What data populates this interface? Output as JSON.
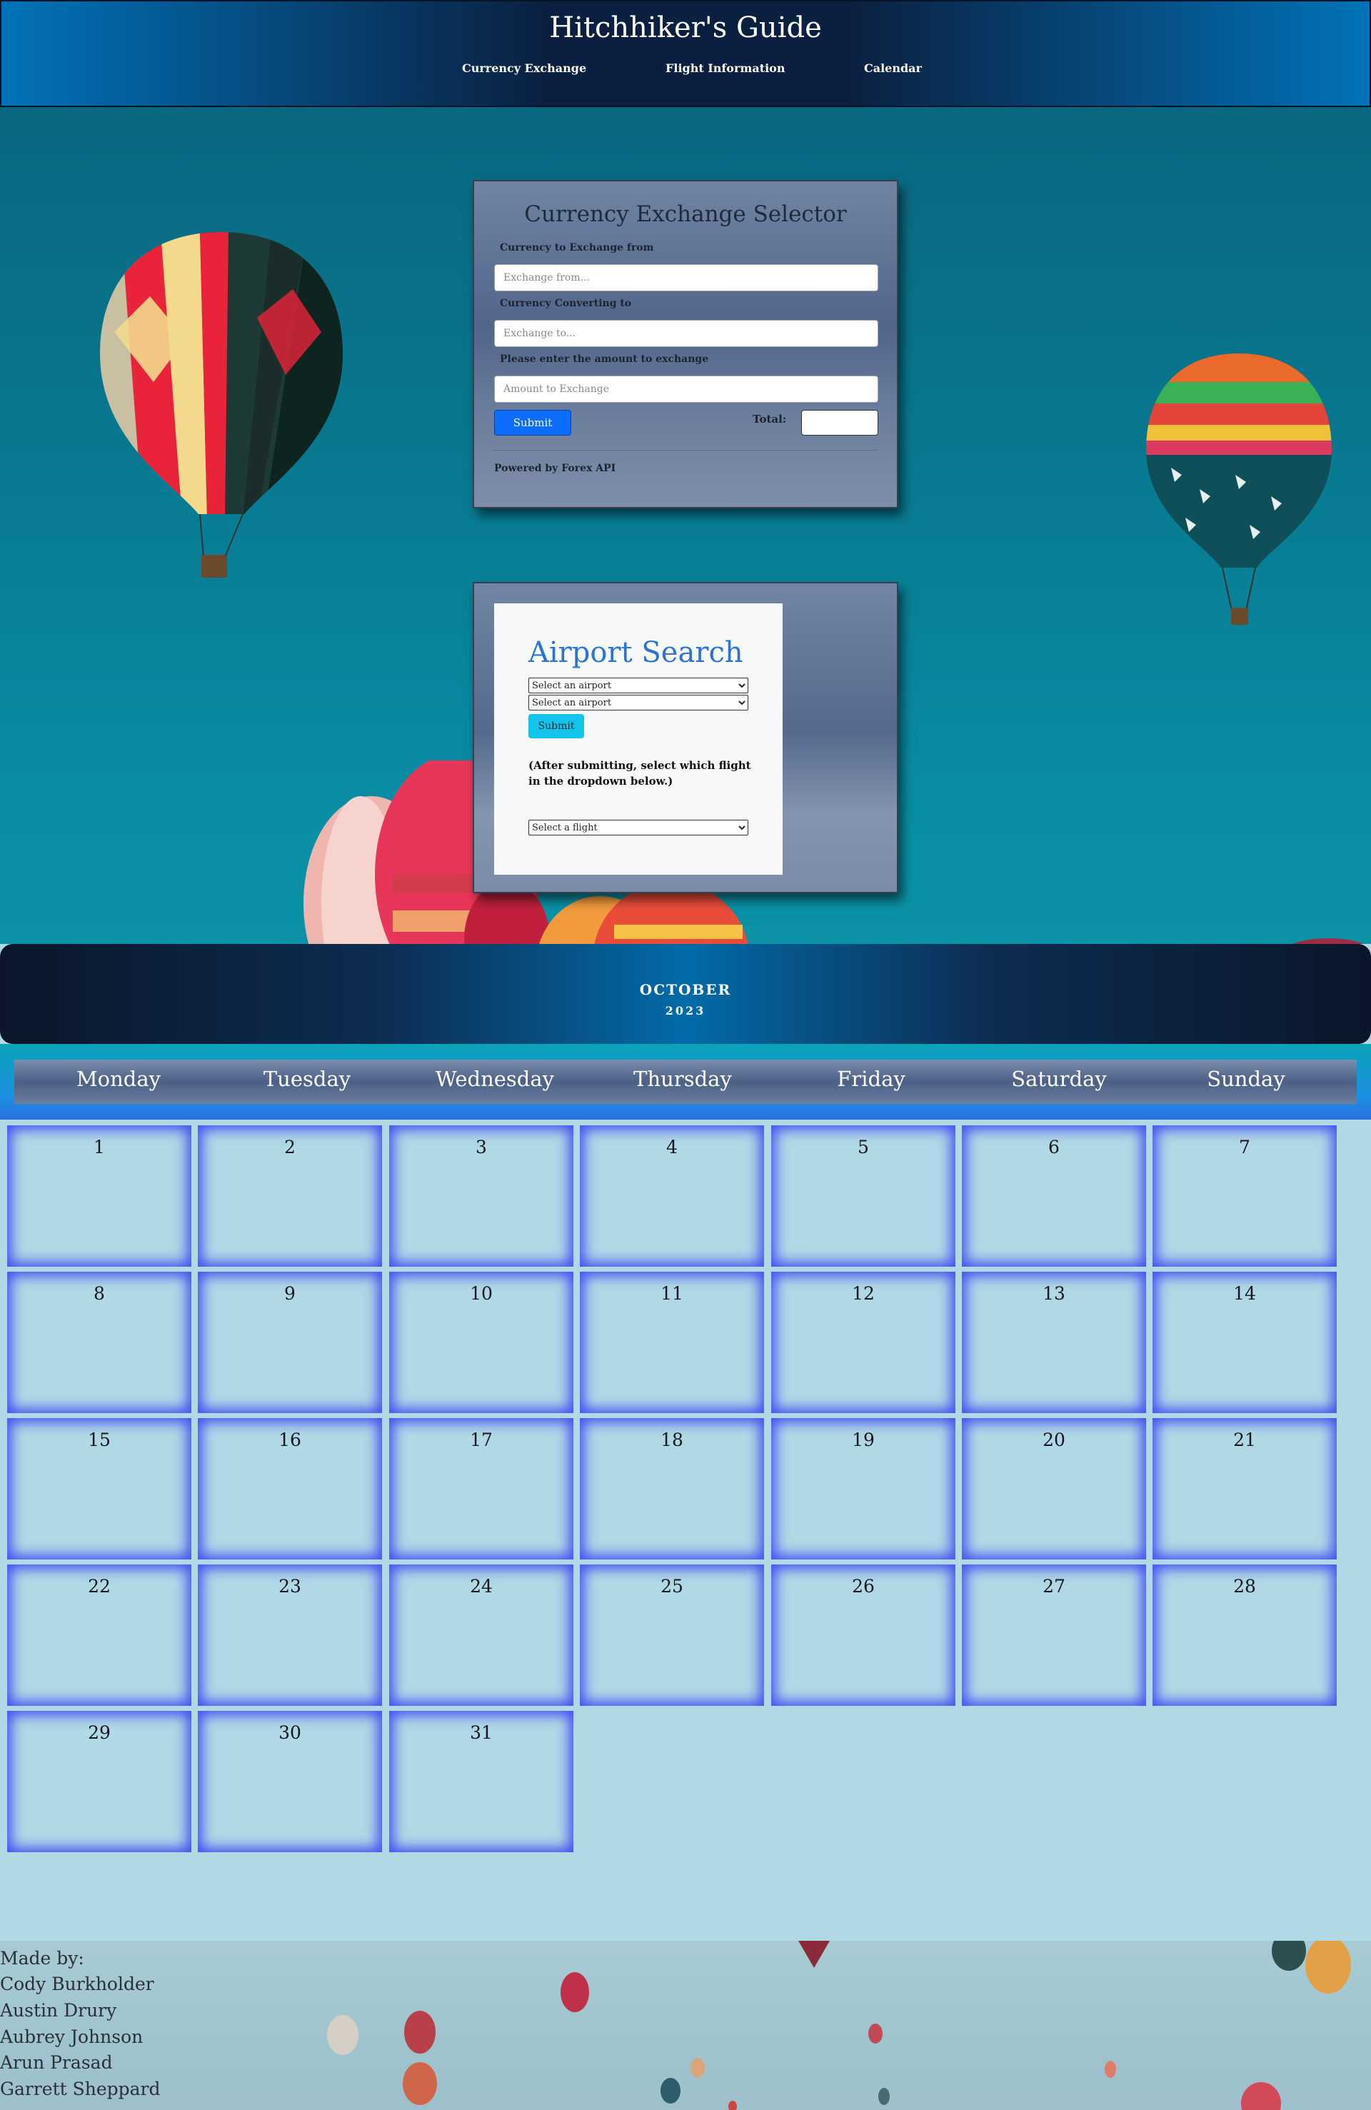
{
  "header": {
    "title": "Hitchhiker's Guide",
    "nav": [
      {
        "label": "Currency Exchange"
      },
      {
        "label": "Flight Information"
      },
      {
        "label": "Calendar"
      }
    ]
  },
  "currency": {
    "title": "Currency Exchange Selector",
    "from_label": "Currency to Exchange from",
    "from_placeholder": "Exchange from...",
    "to_label": "Currency Converting to",
    "to_placeholder": "Exchange to...",
    "amount_label": "Please enter the amount to exchange",
    "amount_placeholder": "Amount to Exchange",
    "submit_label": "Submit",
    "total_label": "Total:",
    "total_value": "",
    "powered_by": "Powered by Forex API"
  },
  "airport": {
    "title": "Airport Search",
    "select1": "Select an airport",
    "select2": "Select an airport",
    "submit_label": "Submit",
    "note": "(After submitting, select which flight in the dropdown below.)",
    "flight_select": "Select a flight"
  },
  "calendar": {
    "month": "OCTOBER",
    "year": "2023",
    "weekdays": [
      "Monday",
      "Tuesday",
      "Wednesday",
      "Thursday",
      "Friday",
      "Saturday",
      "Sunday"
    ],
    "days": [
      "1",
      "2",
      "3",
      "4",
      "5",
      "6",
      "7",
      "8",
      "9",
      "10",
      "11",
      "12",
      "13",
      "14",
      "15",
      "16",
      "17",
      "18",
      "19",
      "20",
      "21",
      "22",
      "23",
      "24",
      "25",
      "26",
      "27",
      "28",
      "29",
      "30",
      "31"
    ]
  },
  "footer": {
    "heading": "Made by:",
    "authors": [
      "Cody Burkholder",
      "Austin Drury",
      "Aubrey Johnson",
      "Arun Prasad",
      "Garrett Sheppard"
    ]
  },
  "colors": {
    "header_dark": "#0b2040",
    "header_blue": "#0173b8",
    "accent_button": "#0d6efd",
    "airport_button": "#13c4ea",
    "airport_title": "#2b74d6",
    "calendar_bg": "#b1d8e5",
    "cell_glow": "#3d4ef2"
  }
}
